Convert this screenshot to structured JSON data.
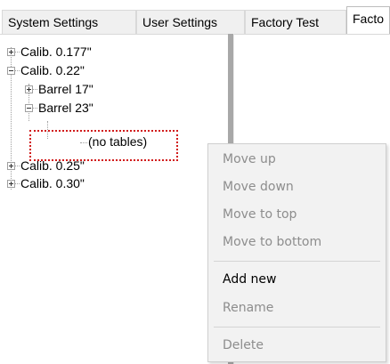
{
  "tabs": [
    {
      "label": "System Settings"
    },
    {
      "label": "User Settings"
    },
    {
      "label": "Factory Test"
    },
    {
      "label": "Facto"
    }
  ],
  "tree": {
    "nodes": [
      {
        "label": "Calib. 0.177\"",
        "expander": "plus"
      },
      {
        "label": "Calib. 0.22\"",
        "expander": "minus"
      },
      {
        "label": "Barrel 17\"",
        "expander": "plus"
      },
      {
        "label": "Barrel 23\"",
        "expander": "minus"
      },
      {
        "label": "(no tables)",
        "expander": "none"
      },
      {
        "label": "Calib. 0.25\"",
        "expander": "plus"
      },
      {
        "label": "Calib. 0.30\"",
        "expander": "plus"
      }
    ]
  },
  "context_menu": {
    "items": [
      {
        "label": "Move up",
        "enabled": false
      },
      {
        "label": "Move down",
        "enabled": false
      },
      {
        "label": "Move to top",
        "enabled": false
      },
      {
        "label": "Move to bottom",
        "enabled": false
      },
      {
        "label": "Add new",
        "enabled": true
      },
      {
        "label": "Rename",
        "enabled": false
      },
      {
        "label": "Delete",
        "enabled": false
      }
    ]
  },
  "colors": {
    "highlight": "#d11a1a",
    "disabled_text": "#8d8d8d",
    "splitter": "#a8a8a8"
  }
}
